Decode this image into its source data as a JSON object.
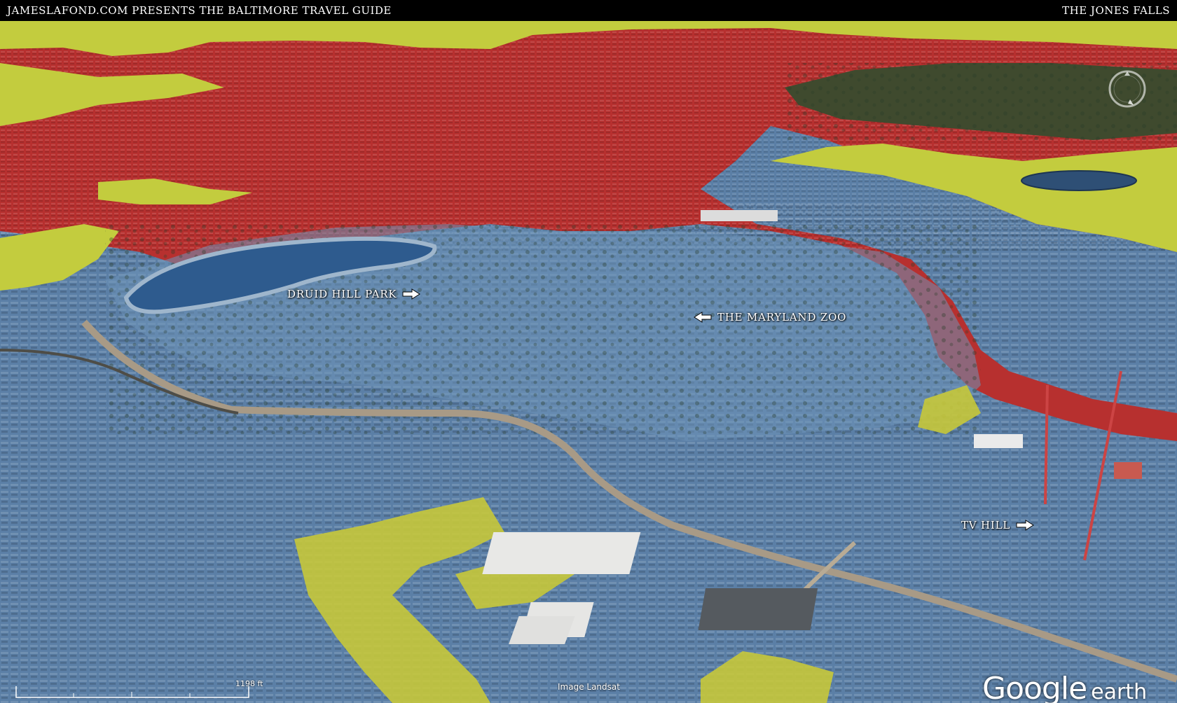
{
  "header": {
    "left_text": "JAMESLAFOND.COM PRESENTS THE BALTIMORE TRAVEL GUIDE",
    "right_text": "THE JONES FALLS"
  },
  "map": {
    "labels": {
      "druid_hill_park": "DRUID HILL PARK",
      "maryland_zoo": "THE MARYLAND ZOO",
      "tv_hill": "TV HILL"
    },
    "scale_text": "1198 ft",
    "imagery_credit": "Image Landsat",
    "brand": {
      "google": "Google",
      "earth": "earth"
    },
    "colors": {
      "red_zone": "#b7302f",
      "yellow_zone": "#c3cc3e",
      "blue_zone": "#5b7fa6",
      "water": "#2e5b8e"
    }
  }
}
